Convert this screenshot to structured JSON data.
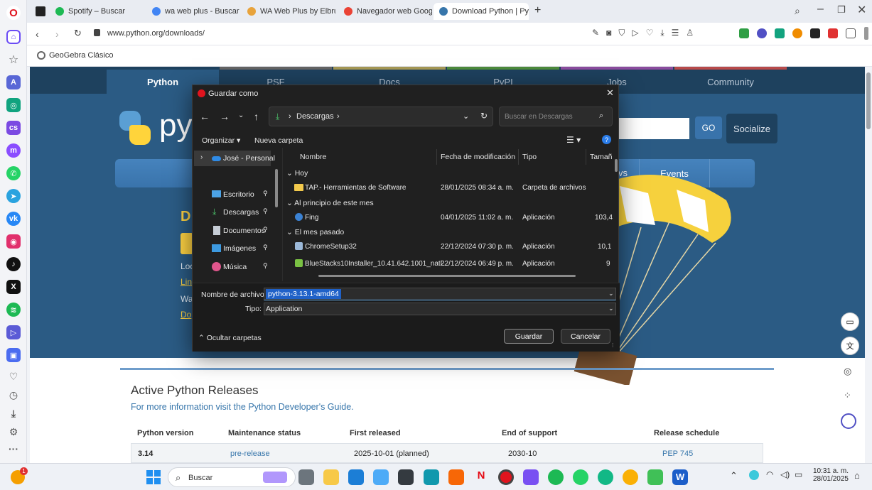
{
  "browser": {
    "tabs": [
      {
        "label": "Spotify – Buscar",
        "color": "#1db954"
      },
      {
        "label": "wa web plus - Buscar con",
        "color": "#4285f4"
      },
      {
        "label": "WA Web Plus by Elbruz Te",
        "color": "#e8a33b"
      },
      {
        "label": "Navegador web Google C",
        "color": "#ea4335"
      },
      {
        "label": "Download Python | Pytho",
        "color": "#3776ab"
      }
    ],
    "url": "www.python.org/downloads/",
    "bookmark": "GeoGebra Clásico"
  },
  "python_page": {
    "nav": [
      "Python",
      "PSF",
      "Docs",
      "PyPI",
      "Jobs",
      "Community"
    ],
    "go_button": "GO",
    "socialize": "Socialize",
    "events": "Events",
    "releases_title": "Active Python Releases",
    "releases_link": "For more information visit the Python Developer's Guide.",
    "table_headers": [
      "Python version",
      "Maintenance status",
      "First released",
      "End of support",
      "Release schedule"
    ],
    "table_row": {
      "version": "3.14",
      "status": "pre-release",
      "released": "2025-10-01 (planned)",
      "end": "2030-10",
      "schedule": "PEP 745"
    },
    "left_fragments": [
      "D",
      "Loo",
      "Lin",
      "Wa",
      "Do"
    ],
    "events_fragment": "vs"
  },
  "dialog": {
    "title": "Guardar como",
    "breadcrumb": "Descargas",
    "search_placeholder": "Buscar en Descargas",
    "organize": "Organizar",
    "new_folder": "Nueva carpeta",
    "sidebar": [
      "José - Personal",
      "Escritorio",
      "Descargas",
      "Documentos",
      "Imágenes",
      "Música"
    ],
    "columns": [
      "Nombre",
      "Fecha de modificación",
      "Tipo",
      "Tamañ"
    ],
    "groups": [
      {
        "label": "Hoy",
        "files": [
          {
            "name": "TAP.- Herramientas de Software",
            "date": "28/01/2025 08:34 a. m.",
            "type": "Carpeta de archivos",
            "size": ""
          }
        ]
      },
      {
        "label": "Al principio de este mes",
        "files": [
          {
            "name": "Fing",
            "date": "04/01/2025 11:02 a. m.",
            "type": "Aplicación",
            "size": "103,4"
          }
        ]
      },
      {
        "label": "El mes pasado",
        "files": [
          {
            "name": "ChromeSetup32",
            "date": "22/12/2024 07:30 p. m.",
            "type": "Aplicación",
            "size": "10,1"
          },
          {
            "name": "BlueStacks10Installer_10.41.642.1001_nati...",
            "date": "22/12/2024 06:49 p. m.",
            "type": "Aplicación",
            "size": "9"
          }
        ]
      }
    ],
    "filename_label": "Nombre de archivo:",
    "filename_value": "python-3.13.1-amd64",
    "type_label": "Tipo:",
    "type_value": "Application",
    "hide_folders": "Ocultar carpetas",
    "save": "Guardar",
    "cancel": "Cancelar"
  },
  "taskbar": {
    "search": "Buscar",
    "time": "10:31 a. m.",
    "date": "28/01/2025",
    "badge": "1"
  }
}
